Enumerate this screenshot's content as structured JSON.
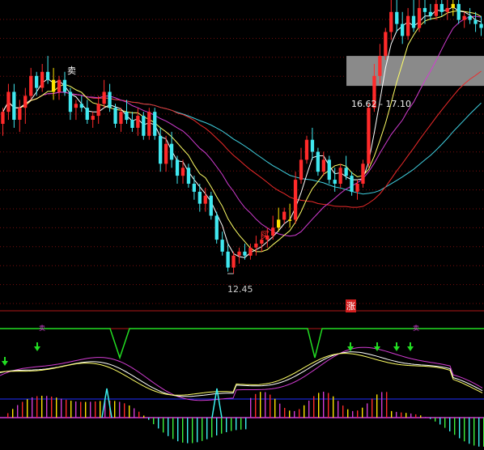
{
  "chart_data": [
    {
      "type": "candlestick",
      "title": "",
      "price_range": [
        11.6,
        19.3
      ],
      "annotations": {
        "low_label": "12.45",
        "range_box_label": "16.62 - 17.10",
        "buy_marker": "买",
        "sell_marker": "卖",
        "rise_marker": "涨"
      },
      "colors": {
        "up": "#ff2a2a",
        "down": "#40e8f0",
        "doji": "#ffe400",
        "ma_short": "#ffffff",
        "ma_mid": "#ffff66",
        "ma_long1": "#d13cd1",
        "ma_long2": "#ee2a2a",
        "ma_long3": "#40d0e0"
      },
      "candles": [
        [
          16.2,
          16.6,
          15.9,
          16.5
        ],
        [
          16.5,
          17.2,
          16.3,
          17.0
        ],
        [
          17.0,
          17.2,
          16.1,
          16.3
        ],
        [
          16.3,
          16.8,
          16.0,
          16.6
        ],
        [
          16.6,
          17.1,
          16.2,
          16.9
        ],
        [
          16.9,
          17.6,
          16.8,
          17.4
        ],
        [
          17.4,
          17.5,
          16.9,
          17.1
        ],
        [
          17.1,
          17.7,
          17.0,
          17.5
        ],
        [
          17.5,
          17.9,
          17.2,
          17.3
        ],
        [
          17.3,
          17.6,
          16.8,
          17.0
        ],
        [
          17.0,
          17.4,
          16.8,
          17.3
        ],
        [
          17.3,
          17.5,
          16.9,
          17.0
        ],
        [
          17.0,
          17.1,
          16.3,
          16.5
        ],
        [
          16.6,
          16.8,
          16.3,
          16.7
        ],
        [
          16.7,
          16.9,
          16.5,
          16.6
        ],
        [
          16.6,
          16.8,
          16.2,
          16.3
        ],
        [
          16.3,
          16.5,
          16.1,
          16.4
        ],
        [
          16.4,
          16.9,
          16.2,
          16.7
        ],
        [
          16.7,
          17.3,
          16.6,
          17.0
        ],
        [
          17.0,
          17.2,
          16.5,
          16.6
        ],
        [
          16.6,
          16.7,
          16.1,
          16.2
        ],
        [
          16.2,
          16.6,
          16.0,
          16.5
        ],
        [
          16.5,
          16.8,
          16.2,
          16.3
        ],
        [
          16.3,
          16.5,
          16.0,
          16.1
        ],
        [
          16.1,
          16.6,
          15.9,
          16.4
        ],
        [
          16.4,
          16.5,
          15.8,
          15.9
        ],
        [
          15.9,
          16.6,
          15.8,
          16.5
        ],
        [
          16.5,
          16.6,
          15.8,
          15.9
        ],
        [
          15.9,
          16.1,
          15.0,
          15.2
        ],
        [
          15.2,
          15.9,
          15.0,
          15.7
        ],
        [
          15.7,
          16.0,
          15.1,
          15.3
        ],
        [
          15.3,
          15.4,
          14.7,
          14.9
        ],
        [
          14.9,
          15.3,
          14.7,
          15.1
        ],
        [
          15.1,
          15.2,
          14.6,
          14.7
        ],
        [
          14.7,
          14.9,
          14.3,
          14.5
        ],
        [
          14.5,
          14.7,
          14.0,
          14.2
        ],
        [
          14.2,
          14.6,
          14.0,
          14.4
        ],
        [
          14.4,
          14.5,
          13.8,
          13.9
        ],
        [
          13.9,
          14.0,
          13.2,
          13.3
        ],
        [
          13.3,
          13.5,
          12.9,
          13.0
        ],
        [
          13.0,
          13.2,
          12.5,
          12.6
        ],
        [
          12.6,
          13.0,
          12.45,
          12.9
        ],
        [
          12.9,
          13.1,
          12.7,
          13.0
        ],
        [
          13.0,
          13.2,
          12.8,
          12.9
        ],
        [
          12.9,
          13.2,
          12.8,
          13.1
        ],
        [
          13.1,
          13.4,
          12.9,
          13.2
        ],
        [
          13.2,
          13.5,
          13.0,
          13.3
        ],
        [
          13.3,
          13.6,
          13.1,
          13.4
        ],
        [
          13.4,
          13.9,
          13.3,
          13.6
        ],
        [
          13.6,
          14.1,
          13.5,
          13.8
        ],
        [
          13.8,
          14.1,
          13.7,
          14.0
        ],
        [
          13.8,
          14.2,
          13.6,
          13.8
        ],
        [
          13.8,
          15.0,
          13.7,
          14.8
        ],
        [
          14.8,
          15.6,
          14.7,
          15.3
        ],
        [
          15.3,
          15.9,
          15.2,
          15.8
        ],
        [
          15.8,
          16.1,
          15.3,
          15.5
        ],
        [
          15.5,
          15.6,
          14.9,
          15.0
        ],
        [
          15.0,
          15.5,
          14.9,
          15.3
        ],
        [
          15.3,
          15.4,
          14.7,
          14.8
        ],
        [
          14.8,
          15.1,
          14.5,
          14.7
        ],
        [
          14.7,
          15.2,
          14.6,
          15.1
        ],
        [
          15.1,
          15.4,
          14.8,
          14.9
        ],
        [
          14.9,
          15.0,
          14.4,
          14.5
        ],
        [
          14.5,
          14.8,
          14.3,
          14.7
        ],
        [
          14.7,
          15.3,
          14.6,
          15.2
        ],
        [
          15.2,
          16.7,
          15.1,
          16.6
        ],
        [
          16.6,
          17.7,
          16.5,
          17.4
        ],
        [
          17.4,
          18.2,
          17.2,
          17.9
        ],
        [
          17.9,
          18.6,
          17.8,
          18.5
        ],
        [
          18.5,
          19.3,
          18.3,
          19.0
        ],
        [
          19.0,
          19.3,
          18.5,
          18.7
        ],
        [
          18.7,
          19.0,
          18.2,
          18.4
        ],
        [
          18.4,
          19.1,
          18.3,
          18.9
        ],
        [
          18.9,
          19.3,
          18.5,
          18.6
        ],
        [
          18.6,
          19.3,
          18.5,
          19.1
        ],
        [
          19.1,
          19.3,
          18.7,
          19.0
        ],
        [
          19.0,
          19.2,
          18.8,
          18.9
        ],
        [
          18.9,
          19.3,
          18.8,
          19.2
        ],
        [
          19.2,
          19.3,
          18.9,
          19.0
        ],
        [
          19.0,
          19.3,
          18.8,
          19.1
        ],
        [
          19.1,
          19.3,
          18.9,
          19.2
        ],
        [
          19.2,
          19.3,
          18.7,
          18.8
        ],
        [
          18.8,
          19.0,
          18.6,
          18.9
        ],
        [
          18.9,
          19.1,
          18.7,
          18.8
        ],
        [
          18.8,
          19.0,
          18.5,
          18.7
        ],
        [
          18.7,
          18.9,
          18.4,
          18.6
        ]
      ]
    },
    {
      "type": "line",
      "title": "",
      "ylim": [
        -1,
        1
      ],
      "sell_markers": [
        "卖",
        "卖"
      ],
      "series_count": 4
    }
  ]
}
